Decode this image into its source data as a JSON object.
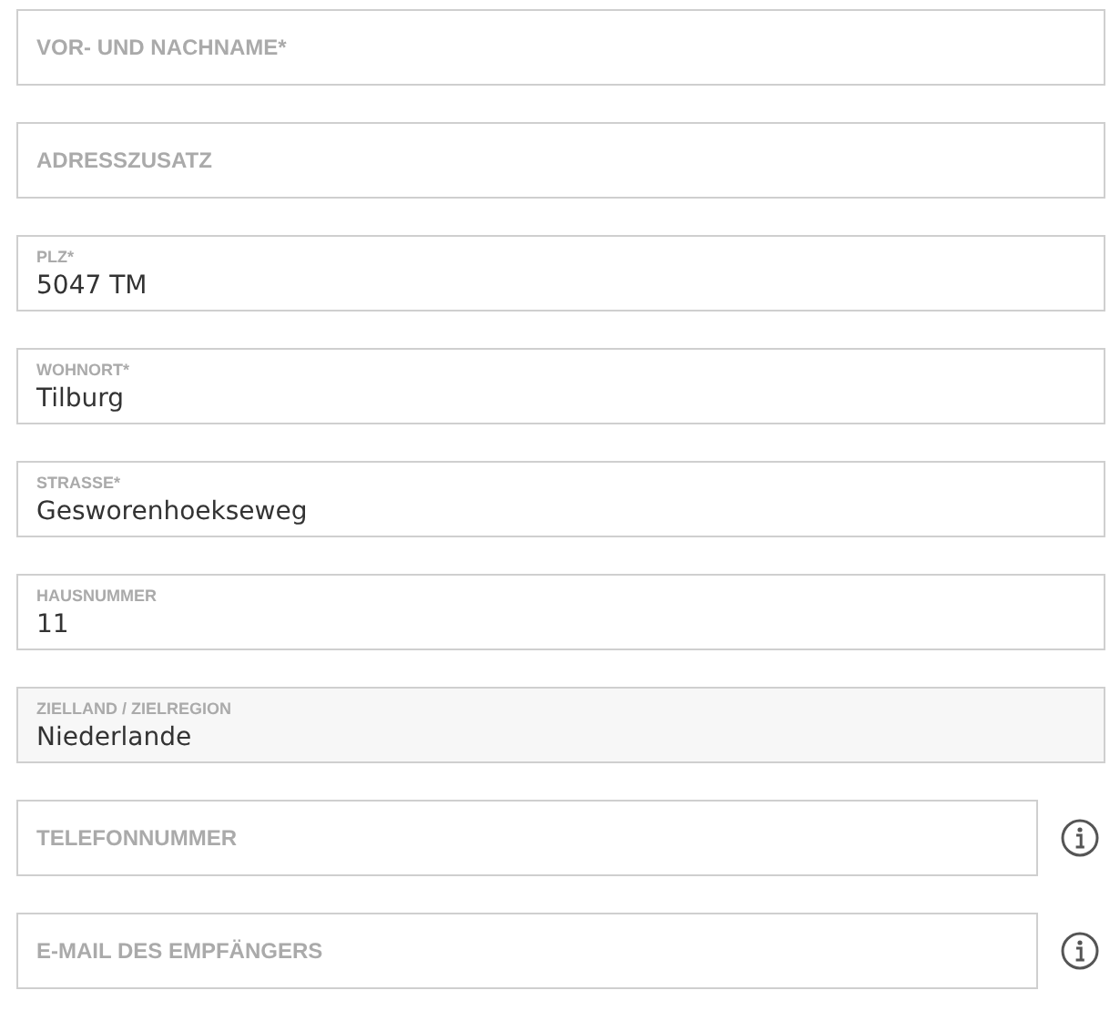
{
  "fields": [
    {
      "placeholder": "VOR- UND NACHNAME*",
      "disabled": false,
      "info": false
    },
    {
      "placeholder": "ADRESSZUSATZ",
      "disabled": false,
      "info": false
    },
    {
      "label": "PLZ*",
      "value": "5047 TM",
      "disabled": false,
      "info": false
    },
    {
      "label": "WOHNORT*",
      "value": "Tilburg",
      "disabled": false,
      "info": false
    },
    {
      "label": "STRASSE*",
      "value": "Gesworenhoekseweg",
      "disabled": false,
      "info": false
    },
    {
      "label": "HAUSNUMMER",
      "value": "11",
      "disabled": false,
      "info": false
    },
    {
      "label": "ZIELLAND / ZIELREGION",
      "value": "Niederlande",
      "disabled": true,
      "info": false
    },
    {
      "placeholder": "TELEFONNUMMER",
      "disabled": false,
      "info": true
    },
    {
      "placeholder": "E-MAIL DES EMPFÄNGERS",
      "disabled": false,
      "info": true
    }
  ]
}
